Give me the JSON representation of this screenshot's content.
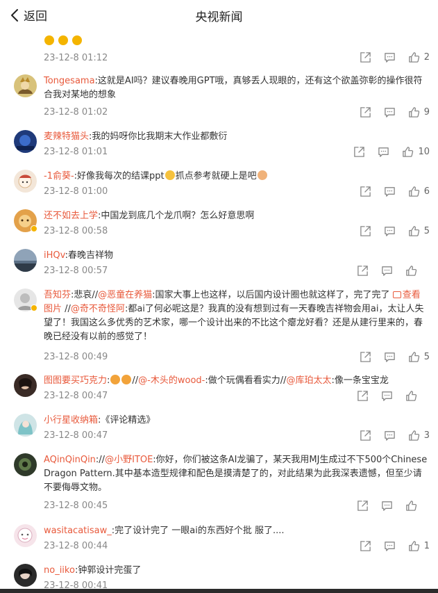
{
  "header": {
    "back_label": "返回",
    "title": "央视新闻"
  },
  "comments": [
    {
      "user": "",
      "parts": [],
      "time": "23-12-8 01:12",
      "likes": "2"
    },
    {
      "user": "Tongesama",
      "parts": [
        {
          "t": ":这就是AI吗？建议春晚用GPT哦，真够丢人现眼的，还有这个欲盖弥彰的操作很符合我对某地的想象"
        }
      ],
      "time": "23-12-8 01:02",
      "likes": "9"
    },
    {
      "user": "麦辣特猫头",
      "parts": [
        {
          "t": ":我的妈呀你比我期末大作业都敷衍"
        }
      ],
      "time": "23-12-8 01:01",
      "likes": "10"
    },
    {
      "user": "-1俞葵-",
      "parts": [
        {
          "t": ":好像我每次的结课ppt"
        },
        {
          "t": "抓点参考就硬上是吧"
        }
      ],
      "time": "23-12-8 01:00",
      "likes": "6"
    },
    {
      "user": "还不如去上学",
      "parts": [
        {
          "t": ":中国龙到底几个龙爪啊？怎么好意思啊"
        }
      ],
      "time": "23-12-8 00:58",
      "likes": "5"
    },
    {
      "user": "iHQv",
      "parts": [
        {
          "t": ":春晚吉祥物"
        }
      ],
      "time": "23-12-8 00:57",
      "likes": ""
    },
    {
      "user": "吾知芬",
      "parts": [
        {
          "t": ":悲哀//"
        },
        {
          "m": "@恶童在养猫"
        },
        {
          "t": ":国家大事上也这样，以后国内设计圈也就这样了，完了完了 "
        },
        {
          "m": "查看图片"
        },
        {
          "t": " //"
        },
        {
          "m": "@奇不奇怪阿"
        },
        {
          "t": ":都ai了何必呢这是？我真的没有想到过有一天春晚吉祥物会用ai，太让人失望了！我国这么多优秀的艺术家，哪一个设计出来的不比这个瘪龙好看？还是从建行里来的，春晚已经没有以前的感觉了！"
        }
      ],
      "time": "23-12-8 00:49",
      "likes": "5"
    },
    {
      "user": "图图要买巧克力",
      "parts": [
        {
          "t": ":"
        },
        {
          "t": "//"
        },
        {
          "m": "@-木头的wood-"
        },
        {
          "t": ":做个玩偶看看实力//"
        },
        {
          "m": "@库珀太太"
        },
        {
          "t": ":像一条宝宝龙"
        }
      ],
      "time": "23-12-8 00:47",
      "likes": ""
    },
    {
      "user": "小行星收纳箱",
      "parts": [
        {
          "t": ":《评论精选》"
        }
      ],
      "time": "23-12-8 00:47",
      "likes": "3"
    },
    {
      "user": "AQinQinQin",
      "parts": [
        {
          "t": "://"
        },
        {
          "m": "@小野ITOE"
        },
        {
          "t": ":你好，你们被这条AI龙骗了，某天我用MJ生成过不下500个Chinese Dragon Pattern.其中基本造型规律和配色是摸清楚了的，对此结果为此我深表遗憾，但至少请不要侮辱文物。"
        }
      ],
      "time": "23-12-8 00:45",
      "likes": ""
    },
    {
      "user": "wasitacatisaw_",
      "parts": [
        {
          "t": ":完了设计完了 一眼ai的东西好个批 服了...."
        }
      ],
      "time": "23-12-8 00:44",
      "likes": "1"
    },
    {
      "user": "no_iiko",
      "parts": [
        {
          "t": ":钟郭设计完蛋了"
        }
      ],
      "time": "23-12-8 00:41",
      "likes": ""
    }
  ],
  "colors": {
    "accent": "#e8593b",
    "meta": "#888888",
    "text": "#333333",
    "bottom_bar": "#2b2b2b"
  },
  "icons": [
    "chevron-left-icon",
    "share-icon",
    "comment-icon",
    "like-icon"
  ]
}
